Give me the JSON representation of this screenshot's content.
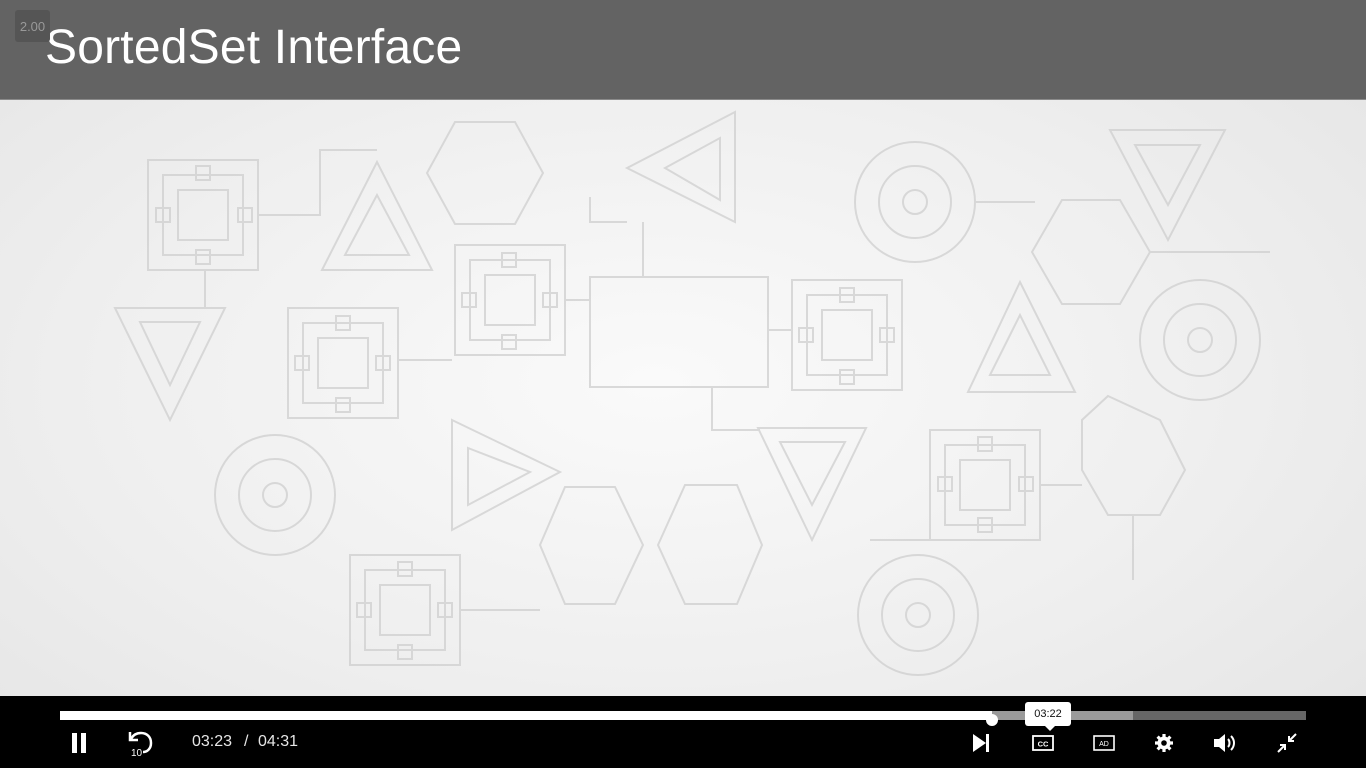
{
  "slide": {
    "title": "SortedSet Interface",
    "speed_badge": "2.00"
  },
  "player": {
    "current_time": "03:23",
    "separator": "/",
    "duration": "04:31",
    "hover_time": "03:22",
    "progress_fraction": 0.748,
    "buffered_fraction": 0.861,
    "colors": {
      "bar_background": "#000000",
      "track": "#666666",
      "buffered": "#9a9a9a",
      "played": "#ffffff",
      "header": "#636363"
    },
    "icons": [
      "pause-icon",
      "replay-10-icon",
      "skip-next-icon",
      "closed-captions-icon",
      "audio-description-icon",
      "settings-gear-icon",
      "volume-icon",
      "exit-fullscreen-icon"
    ],
    "replay_seconds": "10",
    "cc_label": "CC",
    "ad_label": "AD"
  }
}
